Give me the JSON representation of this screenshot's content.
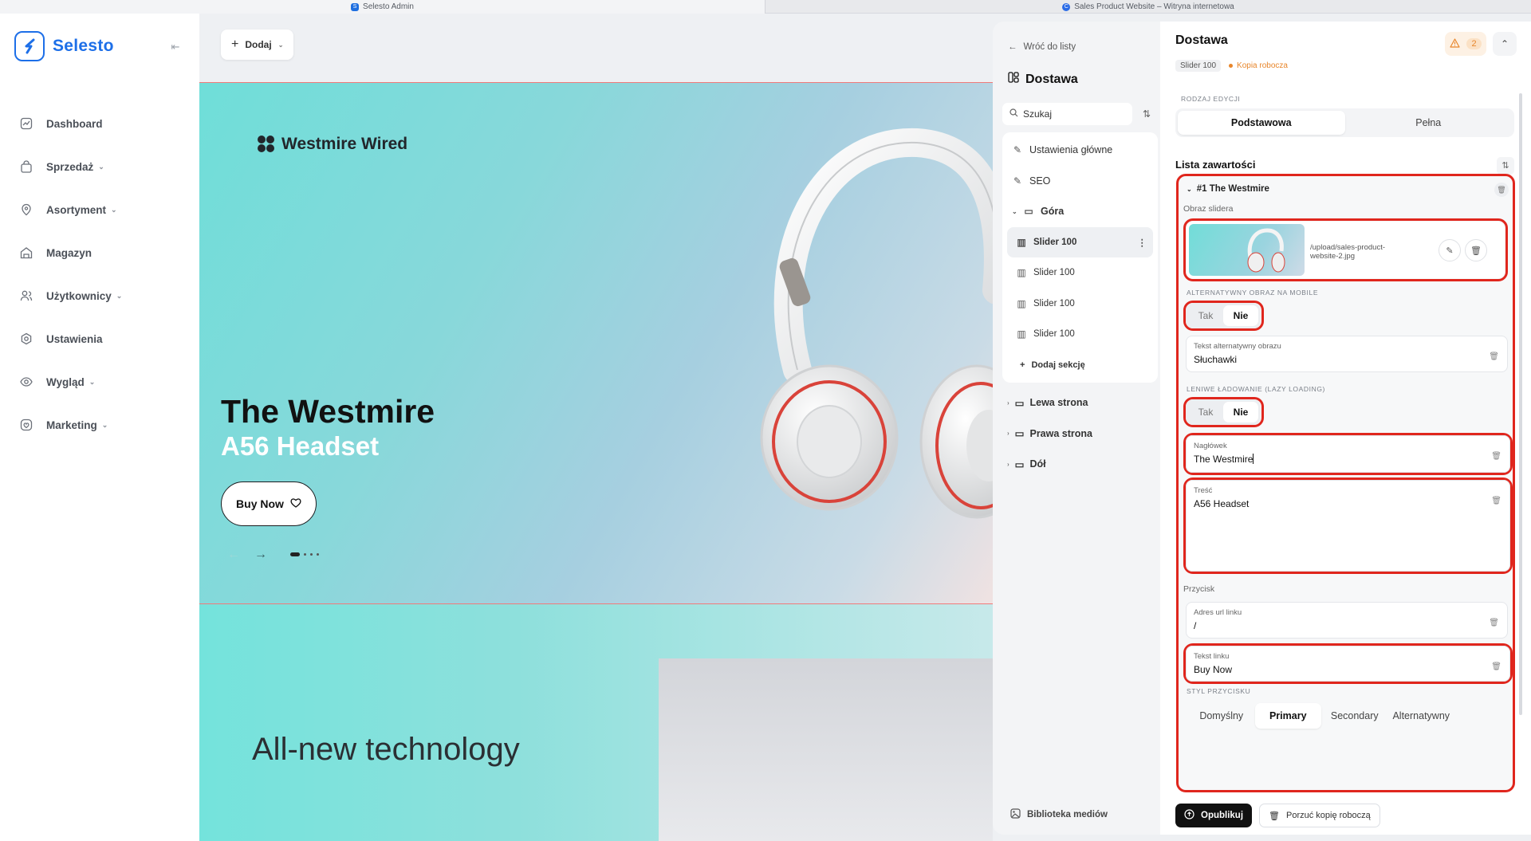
{
  "browser": {
    "tabs": [
      {
        "label": "Selesto Admin",
        "icon": "selesto-favicon"
      },
      {
        "label": "Sales Product Website – Witryna internetowa",
        "icon": "site-favicon"
      }
    ]
  },
  "sidebar": {
    "logo_text": "Selesto",
    "items": [
      {
        "label": "Dashboard",
        "icon": "chart-icon",
        "has_children": false
      },
      {
        "label": "Sprzedaż",
        "icon": "bag-icon",
        "has_children": true
      },
      {
        "label": "Asortyment",
        "icon": "tag-icon",
        "has_children": true
      },
      {
        "label": "Magazyn",
        "icon": "warehouse-icon",
        "has_children": false
      },
      {
        "label": "Użytkownicy",
        "icon": "users-icon",
        "has_children": true
      },
      {
        "label": "Ustawienia",
        "icon": "gear-icon",
        "has_children": false
      },
      {
        "label": "Wygląd",
        "icon": "eye-icon",
        "has_children": true
      },
      {
        "label": "Marketing",
        "icon": "marketing-icon",
        "has_children": true
      }
    ]
  },
  "canvas": {
    "add_label": "Dodaj",
    "hero": {
      "brand": "Westmire Wired",
      "title": "The Westmire",
      "subtitle": "A56 Headset",
      "button": "Buy Now"
    },
    "lower_text": "All-new technology"
  },
  "structure": {
    "back_label": "Wróć do listy",
    "title": "Dostawa",
    "search_placeholder": "Szukaj",
    "group_items": [
      {
        "label": "Ustawienia główne",
        "icon": "edit-icon"
      },
      {
        "label": "SEO",
        "icon": "edit-icon"
      }
    ],
    "folder_open": "Góra",
    "sections": [
      "Slider 100",
      "Slider 100",
      "Slider 100",
      "Slider 100"
    ],
    "add_section": "Dodaj sekcję",
    "folders_closed": [
      "Lewa strona",
      "Prawa strona",
      "Dół"
    ],
    "media_library": "Biblioteka mediów"
  },
  "editor": {
    "title": "Dostawa",
    "badge": "Slider 100",
    "draft": "Kopia robocza",
    "warning_count": "2",
    "edit_type_label": "RODZAJ EDYCJI",
    "edit_types": [
      "Podstawowa",
      "Pełna"
    ],
    "edit_type_selected": "Podstawowa",
    "list_title": "Lista zawartości",
    "item": {
      "title": "#1 The Westmire",
      "image_label": "Obraz slidera",
      "image_path": "/upload/sales-product-website-2.jpg",
      "mobile_label": "ALTERNATYWNY OBRAZ NA MOBILE",
      "lazy_label": "LENIWE ŁADOWANIE (LAZY LOADING)",
      "yes": "Tak",
      "no": "Nie",
      "alt_label": "Tekst alternatywny obrazu",
      "alt_value": "Słuchawki",
      "heading_label": "Nagłówek",
      "heading_value": "The Westmire",
      "content_label": "Treść",
      "content_value": "A56 Headset",
      "button_label": "Przycisk",
      "url_label": "Adres url linku",
      "url_value": "/",
      "link_text_label": "Tekst linku",
      "link_text_value": "Buy Now",
      "style_label": "STYL PRZYCISKU",
      "styles": [
        "Domyślny",
        "Primary",
        "Secondary",
        "Alternatywny"
      ],
      "style_selected": "Primary"
    },
    "publish": "Opublikuj",
    "discard": "Porzuć kopię roboczą"
  },
  "colors": {
    "brand": "#1d6fe8",
    "highlight": "#e0261d",
    "draft": "#e8862b"
  }
}
